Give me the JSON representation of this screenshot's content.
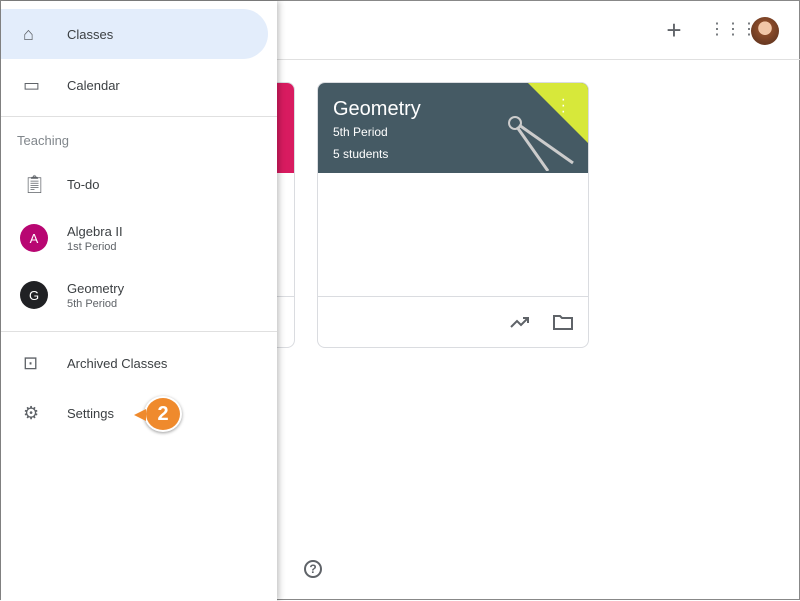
{
  "topbar": {
    "add_icon": "plus-icon",
    "apps_icon": "grid-icon"
  },
  "cards": [
    {
      "title": "Geometry",
      "subtitle": "5th Period",
      "students": "5 students"
    }
  ],
  "drawer": {
    "classes": "Classes",
    "calendar": "Calendar",
    "section": "Teaching",
    "todo": "To-do",
    "teaching": [
      {
        "letter": "A",
        "name": "Algebra II",
        "period": "1st Period",
        "color": "#b80672"
      },
      {
        "letter": "G",
        "name": "Geometry",
        "period": "5th Period",
        "color": "#202124"
      }
    ],
    "archived": "Archived Classes",
    "settings": "Settings"
  },
  "callout": {
    "number": "2",
    "color": "#ef8a2d"
  },
  "help_icon": "?"
}
